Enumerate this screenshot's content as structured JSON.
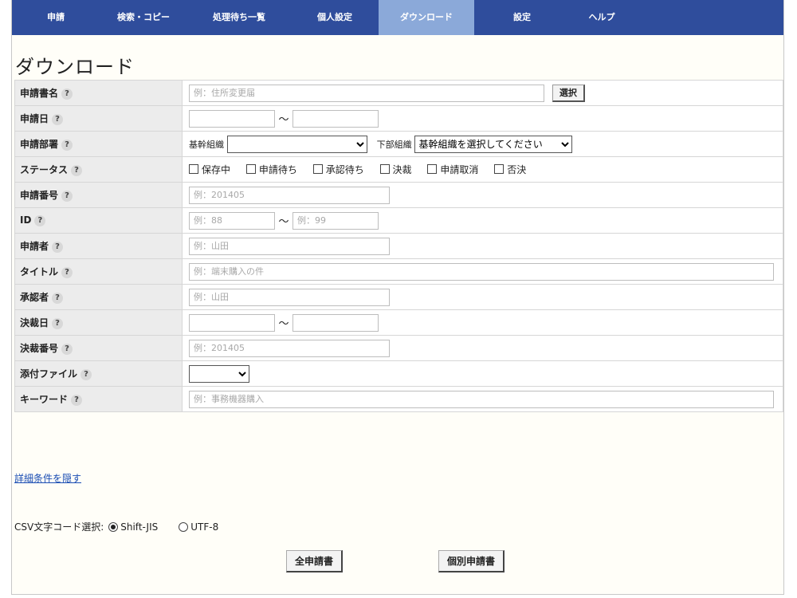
{
  "nav": {
    "items": [
      {
        "label": "申請",
        "active": false
      },
      {
        "label": "検索・コピー",
        "active": false
      },
      {
        "label": "処理待ち一覧",
        "active": false
      },
      {
        "label": "個人設定",
        "active": false
      },
      {
        "label": "ダウンロード",
        "active": true
      },
      {
        "label": "設定",
        "active": false
      },
      {
        "label": "ヘルプ",
        "active": false
      }
    ]
  },
  "page_title": "ダウンロード",
  "help_symbol": "?",
  "form": {
    "form_name": {
      "label": "申請書名",
      "placeholder": "例：住所変更届",
      "button": "選択"
    },
    "apply_date": {
      "label": "申請日",
      "tilde": "～"
    },
    "department": {
      "label": "申請部署",
      "main_label": "基幹組織",
      "main_value": "",
      "sub_label": "下部組織",
      "sub_value": "基幹組織を選択してください"
    },
    "status": {
      "label": "ステータス",
      "options": [
        "保存中",
        "申請待ち",
        "承認待ち",
        "決裁",
        "申請取消",
        "否決"
      ]
    },
    "apply_number": {
      "label": "申請番号",
      "placeholder": "例：201405"
    },
    "id": {
      "label": "ID",
      "from_placeholder": "例：88",
      "to_placeholder": "例：99",
      "tilde": "～"
    },
    "applicant": {
      "label": "申請者",
      "placeholder": "例：山田"
    },
    "title": {
      "label": "タイトル",
      "placeholder": "例：端末購入の件"
    },
    "approver": {
      "label": "承認者",
      "placeholder": "例：山田"
    },
    "decision_date": {
      "label": "決裁日",
      "tilde": "～"
    },
    "decision_number": {
      "label": "決裁番号",
      "placeholder": "例：201405"
    },
    "attachment": {
      "label": "添付ファイル",
      "value": ""
    },
    "keyword": {
      "label": "キーワード",
      "placeholder": "例：事務機器購入"
    }
  },
  "toggle_link": "詳細条件を隠す",
  "csv": {
    "label": "CSV文字コード選択:",
    "options": [
      {
        "label": "Shift-JIS",
        "selected": true
      },
      {
        "label": "UTF-8",
        "selected": false
      }
    ]
  },
  "buttons": {
    "all": "全申請書",
    "individual": "個別申請書"
  }
}
